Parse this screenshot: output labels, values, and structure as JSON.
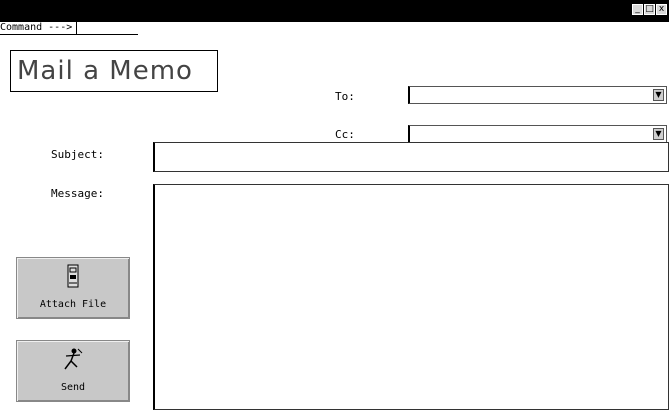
{
  "window": {
    "controls": {
      "minimize": "_",
      "maximize": "□",
      "close": "x"
    }
  },
  "command_bar": {
    "label": "Command --->",
    "value": ""
  },
  "memo": {
    "title": "Mail a Memo"
  },
  "fields": {
    "to_label": "To:",
    "to_value": "",
    "cc_label": "Cc:",
    "cc_value": "",
    "subject_label": "Subject:",
    "subject_value": "",
    "message_label": "Message:",
    "message_value": ""
  },
  "buttons": {
    "attach_label": "Attach File",
    "send_label": "Send"
  },
  "icons": {
    "attach": "file-cabinet-icon",
    "send": "send-figure-icon",
    "dropdown": "chevron-down-icon"
  }
}
